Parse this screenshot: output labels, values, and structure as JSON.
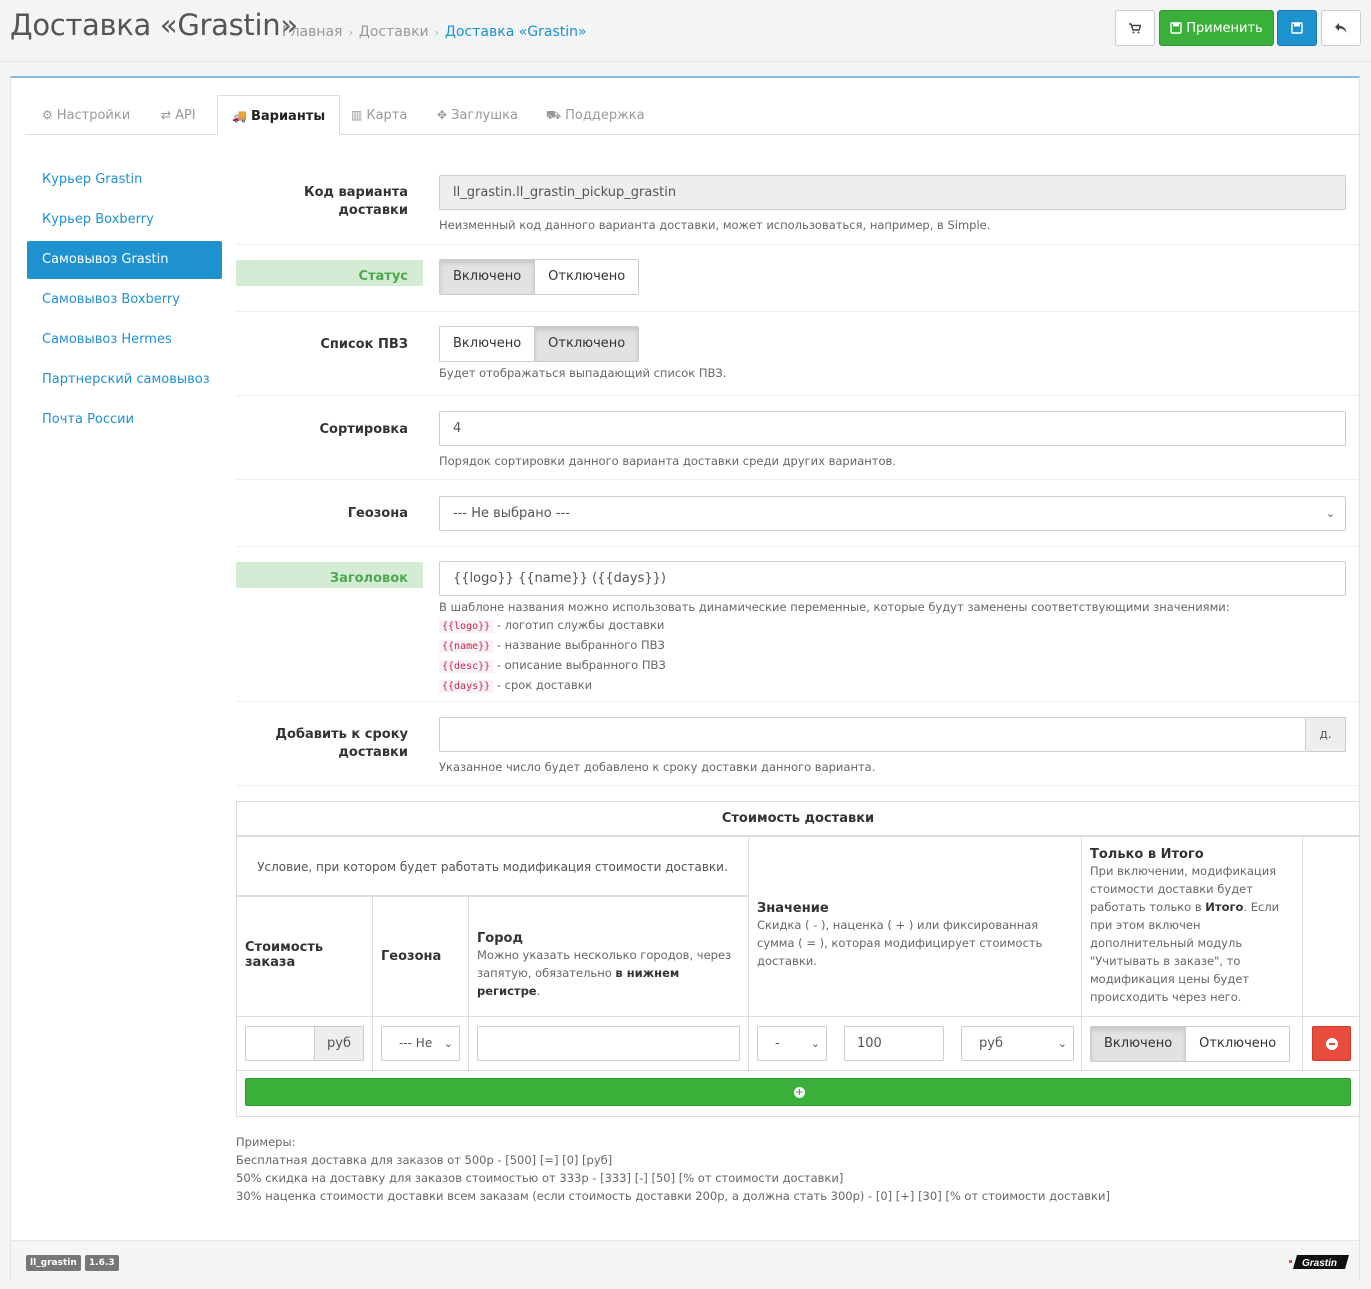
{
  "header": {
    "title": "Доставка «Grastin»",
    "breadcrumb": [
      "Главная",
      "Доставки",
      "Доставка «Grastin»"
    ],
    "apply_label": "Применить"
  },
  "tabs": [
    {
      "label": "Настройки",
      "icon": "cogs-icon"
    },
    {
      "label": "API",
      "icon": "exchange-icon"
    },
    {
      "label": "Варианты",
      "icon": "truck-icon"
    },
    {
      "label": "Карта",
      "icon": "map-icon"
    },
    {
      "label": "Заглушка",
      "icon": "arrows-icon"
    },
    {
      "label": "Поддержка",
      "icon": "cart-icon"
    }
  ],
  "sidebar": {
    "items": [
      {
        "label": "Курьер Grastin"
      },
      {
        "label": "Курьер Boxberry"
      },
      {
        "label": "Самовывоз Grastin"
      },
      {
        "label": "Самовывоз Boxberry"
      },
      {
        "label": "Самовывоз Hermes"
      },
      {
        "label": "Партнерский самовывоз"
      },
      {
        "label": "Почта России"
      }
    ]
  },
  "form": {
    "code": {
      "label": "Код варианта доставки",
      "value": "ll_grastin.ll_grastin_pickup_grastin",
      "help": "Неизменный код данного варианта доставки, может использоваться, например, в Simple."
    },
    "status": {
      "label": "Статус",
      "on": "Включено",
      "off": "Отключено"
    },
    "pvz": {
      "label": "Список ПВЗ",
      "on": "Включено",
      "off": "Отключено",
      "help": "Будет отображаться выпадающий список ПВЗ."
    },
    "sort": {
      "label": "Сортировка",
      "value": "4",
      "help": "Порядок сортировки данного варианта доставки среди других вариантов."
    },
    "geozone": {
      "label": "Геозона",
      "value": "--- Не выбрано ---"
    },
    "heading": {
      "label": "Заголовок",
      "value": "{{logo}} {{name}} ({{days}})",
      "help": "В шаблоне названия можно использовать динамические переменные, которые будут заменены соответствующими значениями:",
      "vars": [
        {
          "code": "{{logo}}",
          "desc": "- логотип службы доставки"
        },
        {
          "code": "{{name}}",
          "desc": "- название выбранного ПВЗ"
        },
        {
          "code": "{{desc}}",
          "desc": "- описание выбранного ПВЗ"
        },
        {
          "code": "{{days}}",
          "desc": "- срок доставки"
        }
      ]
    },
    "adddays": {
      "label": "Добавить к сроку доставки",
      "addon": "д.",
      "help": "Указанное число будет добавлено к сроку доставки данного варианта."
    }
  },
  "cost_table": {
    "title": "Стоимость доставки",
    "condition_header": "Условие, при котором будет работать модификация стоимости доставки.",
    "col_cost": "Стоимость заказа",
    "col_geozone": "Геозона",
    "col_city": "Город",
    "col_city_help": "Можно указать несколько городов, через запятую, обязательно",
    "col_city_help_bold": "в нижнем регистре",
    "col_value": "Значение",
    "col_value_help": "Скидка ( - ), наценка ( + ) или фиксированная сумма ( = ), которая модифицирует стоимость доставки.",
    "col_total": "Только в Итого",
    "col_total_help_1": "При включении, модификация стоимости доставки будет работать только в",
    "col_total_help_bold": "Итого",
    "col_total_help_2": "Если при этом включен дополнительный модуль \"Учитывать в заказе\", то модификация цены будет происходить через него.",
    "row": {
      "cost_value": "",
      "cost_unit": "руб",
      "geozone": "--- Не",
      "city": "",
      "operator": "-",
      "amount": "100",
      "unit": "руб",
      "on": "Включено",
      "off": "Отключено"
    }
  },
  "examples": [
    "Примеры:",
    "Бесплатная доставка для заказов от 500р - [500] [=] [0] [руб]",
    "50% скидка на доставку для заказов стоимостью от 333р - [333] [-] [50] [% от стоимости доставки]",
    "30% наценка стоимости доставки всем заказам (если стоимость доставки 200р, а должна стать 300р) - [0] [+] [30] [% от стоимости доставки]"
  ],
  "footer": {
    "badge_module": "ll_grastin",
    "badge_version": "1.6.3",
    "logo_text": "Grastin"
  },
  "colors": {
    "primary": "#1e91cf",
    "success": "#3ab03a",
    "danger": "#e74c3c",
    "highlight": "#d4ecd4"
  }
}
